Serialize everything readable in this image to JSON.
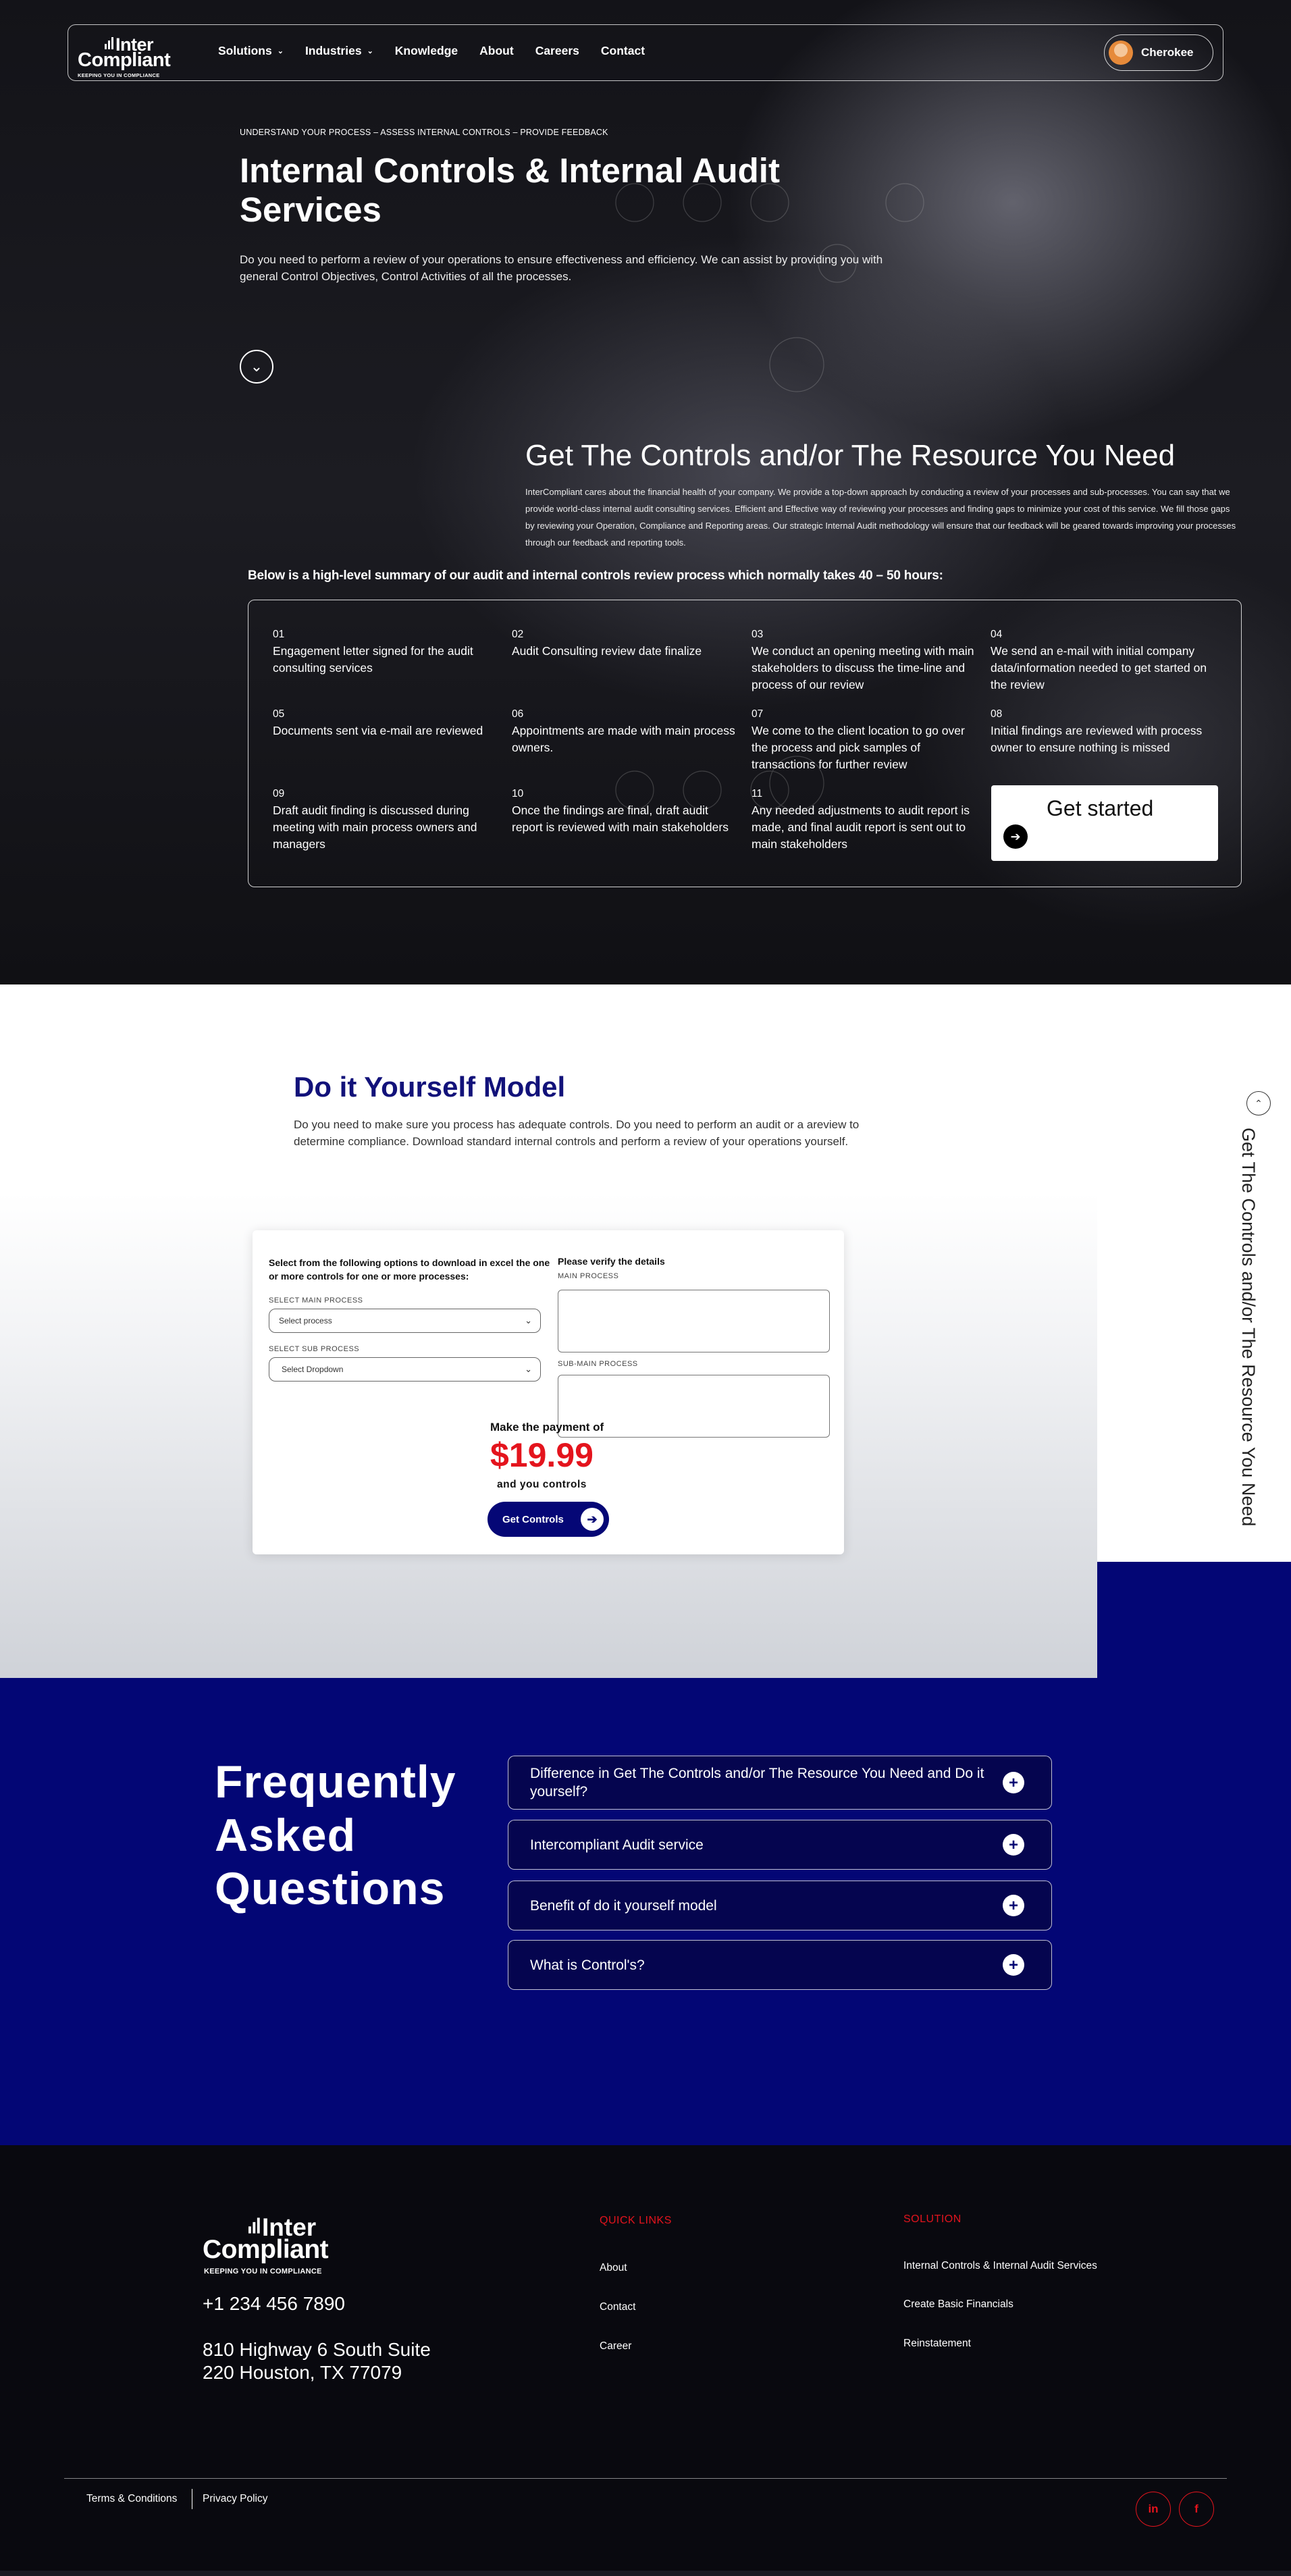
{
  "nav": {
    "logo": {
      "line1": "Inter",
      "line2": "Compliant",
      "tagline": "KEEPING YOU IN COMPLIANCE"
    },
    "menu": [
      {
        "label": "Solutions",
        "has_dropdown": true
      },
      {
        "label": "Industries",
        "has_dropdown": true
      },
      {
        "label": "Knowledge",
        "has_dropdown": false
      },
      {
        "label": "About",
        "has_dropdown": false
      },
      {
        "label": "Careers",
        "has_dropdown": false
      },
      {
        "label": "Contact",
        "has_dropdown": false
      }
    ],
    "user_name": "Cherokee"
  },
  "hero": {
    "eyebrow": "UNDERSTAND YOUR PROCESS – ASSESS INTERNAL CONTROLS – PROVIDE FEEDBACK",
    "title": "Internal Controls & Internal Audit Services",
    "subtitle": "Do you need to perform a review of your operations to ensure effectiveness and efficiency. We can assist by providing you with general Control Objectives, Control Activities of all the processes.",
    "down_icon": "chevron-down-icon"
  },
  "controls": {
    "title": "Get The Controls and/or The Resource You Need",
    "description": "InterCompliant cares about the financial health of your company. We provide a top-down approach by conducting a review of your processes and sub-processes. You can say that we provide world-class internal audit consulting services. Efficient and Effective way of reviewing your processes and finding gaps to minimize your cost of this service. We fill those gaps by reviewing your Operation, Compliance and Reporting areas. Our strategic Internal Audit methodology will ensure that our feedback will be geared towards improving your processes through our feedback and reporting tools.",
    "summary_title": "Below is a high-level summary of our audit and internal controls review process which normally takes 40 – 50 hours:",
    "steps": [
      {
        "num": "01",
        "text": "Engagement letter signed for the audit consulting services"
      },
      {
        "num": "02",
        "text": "Audit Consulting review date finalize"
      },
      {
        "num": "03",
        "text": "We conduct an opening meeting with main stakeholders to discuss the time-line and process of our review"
      },
      {
        "num": "04",
        "text": "We send an e-mail with initial company data/information needed to get started on the review"
      },
      {
        "num": "05",
        "text": "Documents sent via e-mail are reviewed"
      },
      {
        "num": "06",
        "text": "Appointments are made with main process owners."
      },
      {
        "num": "07",
        "text": "We come to the client location to go over the process and pick samples of transactions for further review"
      },
      {
        "num": "08",
        "text": "Initial findings are reviewed with process owner to ensure nothing is missed"
      },
      {
        "num": "09",
        "text": "Draft audit finding is discussed during meeting with main process owners and managers"
      },
      {
        "num": "10",
        "text": "Once the findings are final, draft audit report is reviewed with main stakeholders"
      },
      {
        "num": "11",
        "text": "Any needed adjustments to audit report is made, and final audit report is sent out to main stakeholders"
      }
    ],
    "cta": "Get started"
  },
  "diy": {
    "title": "Do it Yourself Model",
    "description": "Do you need to make sure you process has adequate controls. Do you need to perform an audit or a areview to determine compliance. Download standard internal controls and perform a review of your operations yourself.",
    "form": {
      "intro": "Select from the following options to download in excel the one or more controls for one or more processes:",
      "main_label": "SELECT MAIN PROCESS",
      "main_value": "Select process",
      "sub_label": "SELECT SUB PROCESS",
      "sub_value": "Select Dropdown",
      "verify_title": "Please verify the details",
      "verify_main_label": "MAIN PROCESS",
      "verify_sub_label": "SUB-MAIN PROCESS",
      "payment_label": "Make the payment of",
      "price": "$19.99",
      "price_suffix": "and you controls",
      "button": "Get Controls"
    },
    "side_text": "Get The Controls and/or The Resource You Need"
  },
  "faq": {
    "title_lines": [
      "Frequently",
      "Asked",
      "Questions"
    ],
    "items": [
      "Difference in Get The Controls and/or The Resource You Need and Do it yourself?",
      "Intercompliant Audit service",
      "Benefit of do it yourself model",
      "What is Control's?"
    ]
  },
  "footer": {
    "logo": {
      "line1": "Inter",
      "line2": "Compliant",
      "tagline": "KEEPING YOU IN COMPLIANCE"
    },
    "phone": "+1 234 456 7890",
    "address_line1": "810 Highway 6 South Suite",
    "address_line2": "220 Houston, TX 77079",
    "quick_links_title": "QUICK LINKS",
    "quick_links": [
      "About",
      "Contact",
      "Career"
    ],
    "solution_title": "SOLUTION",
    "solution_links": [
      "Internal Controls & Internal Audit Services",
      "Create Basic Financials",
      "Reinstatement"
    ],
    "terms": "Terms & Conditions",
    "privacy": "Privacy Policy",
    "social": [
      {
        "icon": "linkedin-icon",
        "glyph": "in"
      },
      {
        "icon": "facebook-icon",
        "glyph": "f"
      }
    ]
  },
  "colors": {
    "navy": "#030675",
    "accent_red": "#e4141d",
    "dark": "#09090f"
  }
}
